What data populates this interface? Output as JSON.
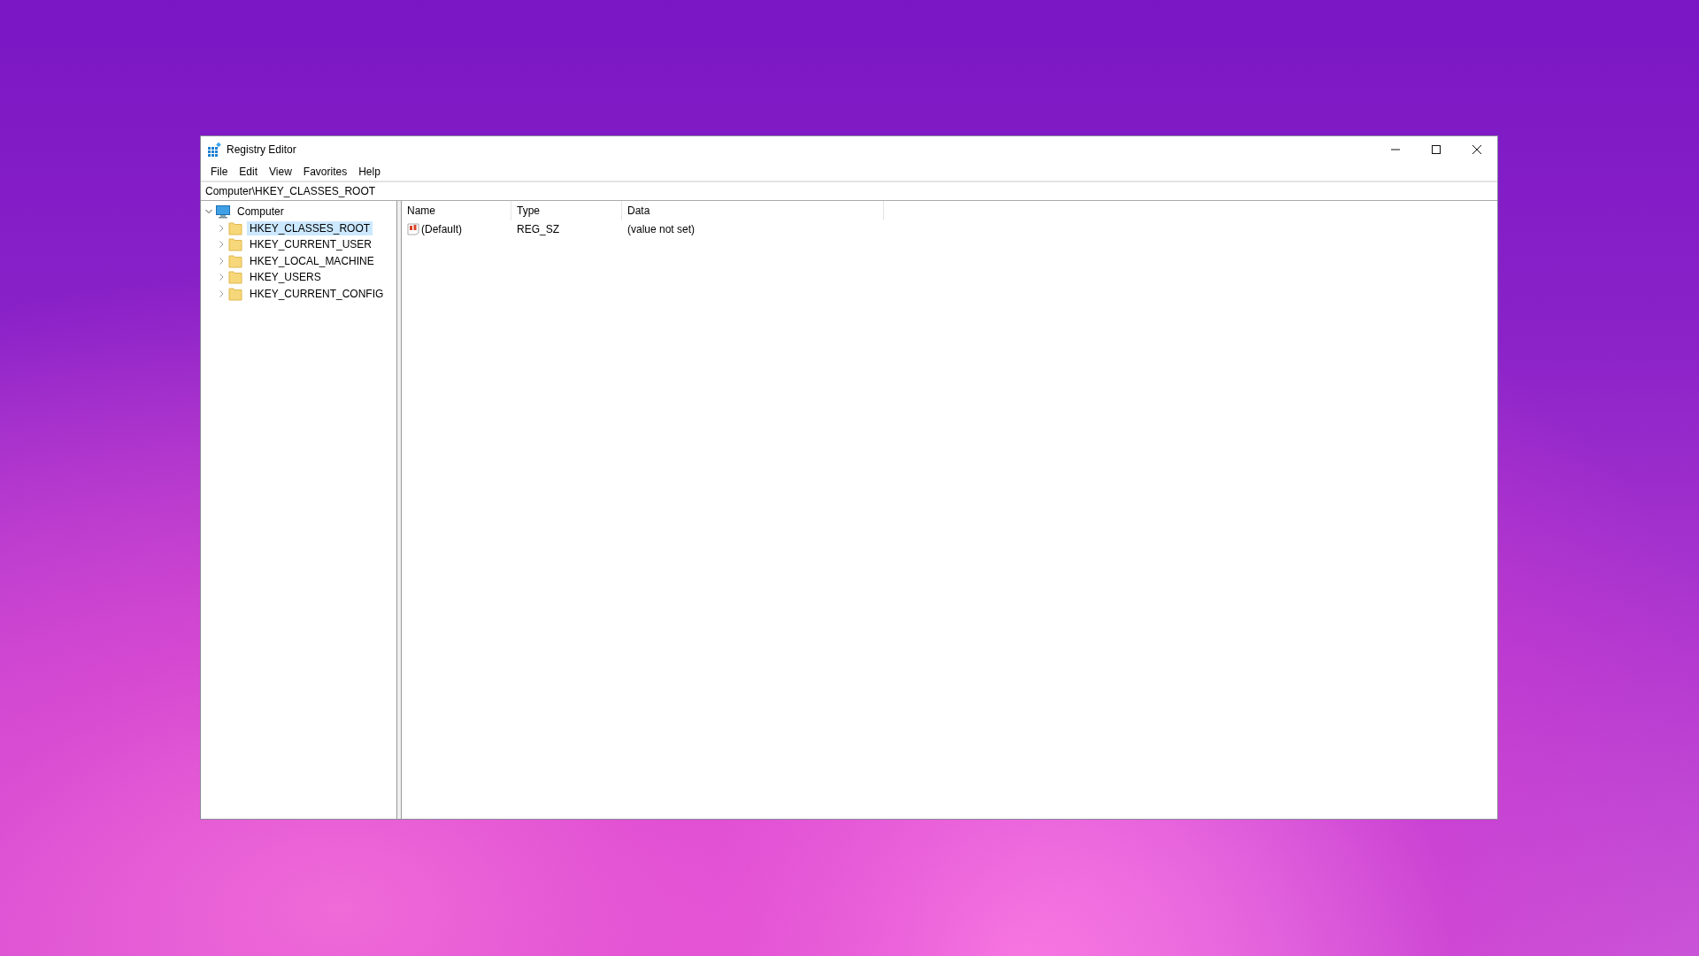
{
  "window": {
    "title": "Registry Editor"
  },
  "menu": [
    {
      "label": "File"
    },
    {
      "label": "Edit"
    },
    {
      "label": "View"
    },
    {
      "label": "Favorites"
    },
    {
      "label": "Help"
    }
  ],
  "address_bar": {
    "value": "Computer\\HKEY_CLASSES_ROOT"
  },
  "tree": [
    {
      "label": "Computer",
      "kind": "computer",
      "expanded": true,
      "selected": false,
      "children": [
        {
          "label": "HKEY_CLASSES_ROOT",
          "kind": "folder",
          "expanded": false,
          "selected": true
        },
        {
          "label": "HKEY_CURRENT_USER",
          "kind": "folder",
          "expanded": false,
          "selected": false
        },
        {
          "label": "HKEY_LOCAL_MACHINE",
          "kind": "folder",
          "expanded": false,
          "selected": false
        },
        {
          "label": "HKEY_USERS",
          "kind": "folder",
          "expanded": false,
          "selected": false
        },
        {
          "label": "HKEY_CURRENT_CONFIG",
          "kind": "folder",
          "expanded": false,
          "selected": false
        }
      ]
    }
  ],
  "table": {
    "columns": [
      "Name",
      "Type",
      "Data"
    ],
    "rows": [
      {
        "name": "(Default)",
        "type": "REG_SZ",
        "data": "(value not set)",
        "kind": "string"
      }
    ]
  }
}
